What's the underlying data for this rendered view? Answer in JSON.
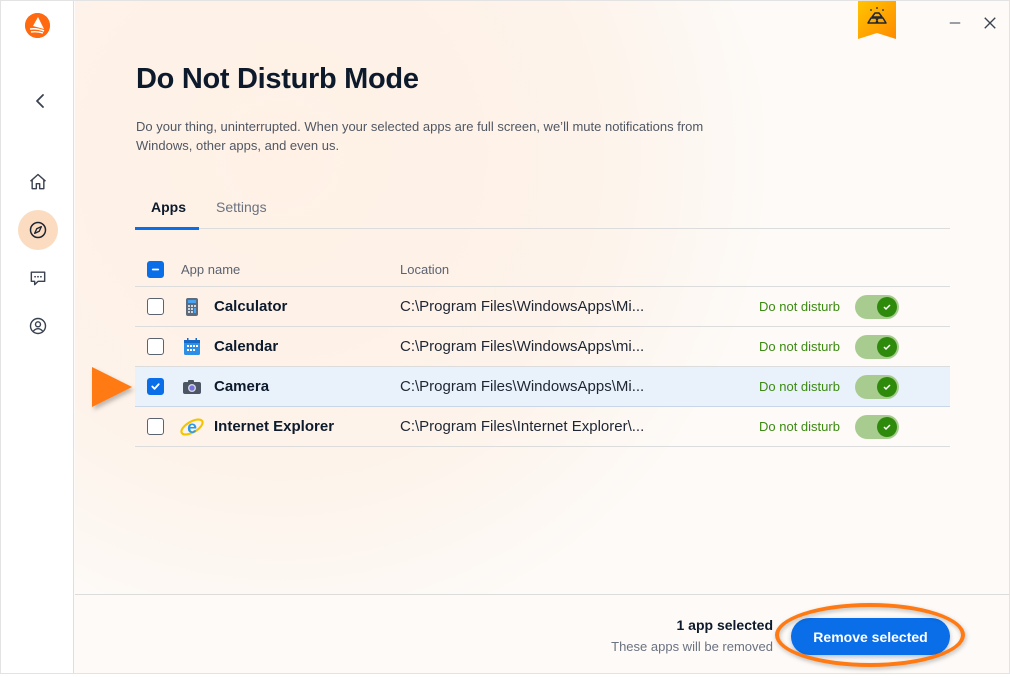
{
  "app": {
    "logo": "avast-logo-icon",
    "back_icon": "chevron-left-icon",
    "badge_icon": "gold-bars-icon",
    "minimize_icon": "minimize-icon",
    "close_icon": "close-icon"
  },
  "sidebar": {
    "items": [
      {
        "icon": "home-icon",
        "active": false
      },
      {
        "icon": "compass-icon",
        "active": true
      },
      {
        "icon": "chat-icon",
        "active": false
      },
      {
        "icon": "account-icon",
        "active": false
      }
    ]
  },
  "page": {
    "title": "Do Not Disturb Mode",
    "description": "Do your thing, uninterrupted. When your selected apps are full screen, we’ll mute notifications from Windows, other apps, and even us."
  },
  "tabs": [
    {
      "label": "Apps",
      "active": true
    },
    {
      "label": "Settings",
      "active": false
    }
  ],
  "table": {
    "select_all_state": "partial",
    "headers": {
      "name": "App name",
      "location": "Location"
    },
    "rows": [
      {
        "name": "Calculator",
        "icon": "calculator-icon",
        "location": "C:\\Program Files\\WindowsApps\\Mi...",
        "status": "Do not disturb",
        "enabled": true,
        "checked": false
      },
      {
        "name": "Calendar",
        "icon": "calendar-icon",
        "location": "C:\\Program Files\\WindowsApps\\mi...",
        "status": "Do not disturb",
        "enabled": true,
        "checked": false
      },
      {
        "name": "Camera",
        "icon": "camera-icon",
        "location": "C:\\Program Files\\WindowsApps\\Mi...",
        "status": "Do not disturb",
        "enabled": true,
        "checked": true
      },
      {
        "name": "Internet Explorer",
        "icon": "internet-explorer-icon",
        "location": "C:\\Program Files\\Internet Explorer\\...",
        "status": "Do not disturb",
        "enabled": true,
        "checked": false
      }
    ]
  },
  "footer": {
    "selected_count": "1 app selected",
    "selected_note": "These apps will be removed",
    "remove_button": "Remove selected"
  },
  "colors": {
    "accent": "#0a6ee8",
    "brand": "#ff6a10",
    "toggle_on": "#2e8a0b",
    "annotation": "#ff7a12"
  }
}
